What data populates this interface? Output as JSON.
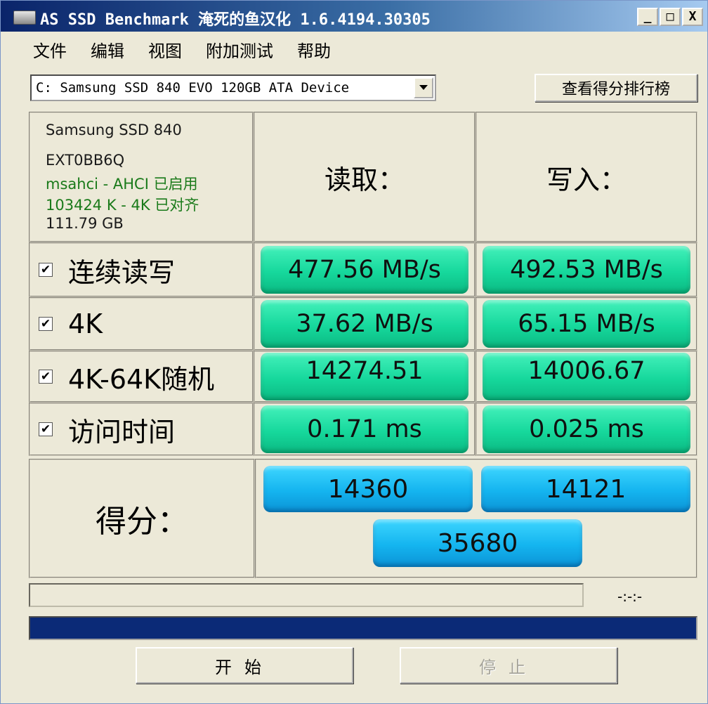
{
  "window": {
    "title": "AS SSD Benchmark 淹死的鱼汉化 1.6.4194.30305",
    "minimize": "_",
    "maximize": "□",
    "close": "X"
  },
  "menu": [
    "文件",
    "编辑",
    "视图",
    "附加测试",
    "帮助"
  ],
  "drive": {
    "selected": "C: Samsung SSD 840 EVO 120GB ATA Device",
    "ranking_button": "查看得分排行榜"
  },
  "info": {
    "model": "Samsung SSD 840",
    "firmware": "EXT0BB6Q",
    "driver": "msahci - AHCI 已启用",
    "alignment": "103424 K - 4K 已对齐",
    "capacity": "111.79 GB"
  },
  "headers": {
    "read": "读取：",
    "write": "写入："
  },
  "rows": [
    {
      "label": "连续读写",
      "checked": true,
      "read": "477.56 MB/s",
      "write": "492.53 MB/s"
    },
    {
      "label": "4K",
      "checked": true,
      "read": "37.62 MB/s",
      "write": "65.15 MB/s"
    },
    {
      "label": "4K-64K随机",
      "checked": true,
      "read": "14274.51",
      "write": "14006.67"
    },
    {
      "label": "访问时间",
      "checked": true,
      "read": "0.171 ms",
      "write": "0.025 ms"
    }
  ],
  "score": {
    "label": "得分：",
    "read": "14360",
    "write": "14121",
    "total": "35680"
  },
  "progress": {
    "time": "-:-:-",
    "main_fraction": 1.0
  },
  "buttons": {
    "start": "开始",
    "stop": "停止"
  },
  "colors": {
    "result_box": "#1ed8a2",
    "score_box": "#16b6f0",
    "progress_fill": "#0b2a77",
    "info_green": "#1a7a1a"
  }
}
